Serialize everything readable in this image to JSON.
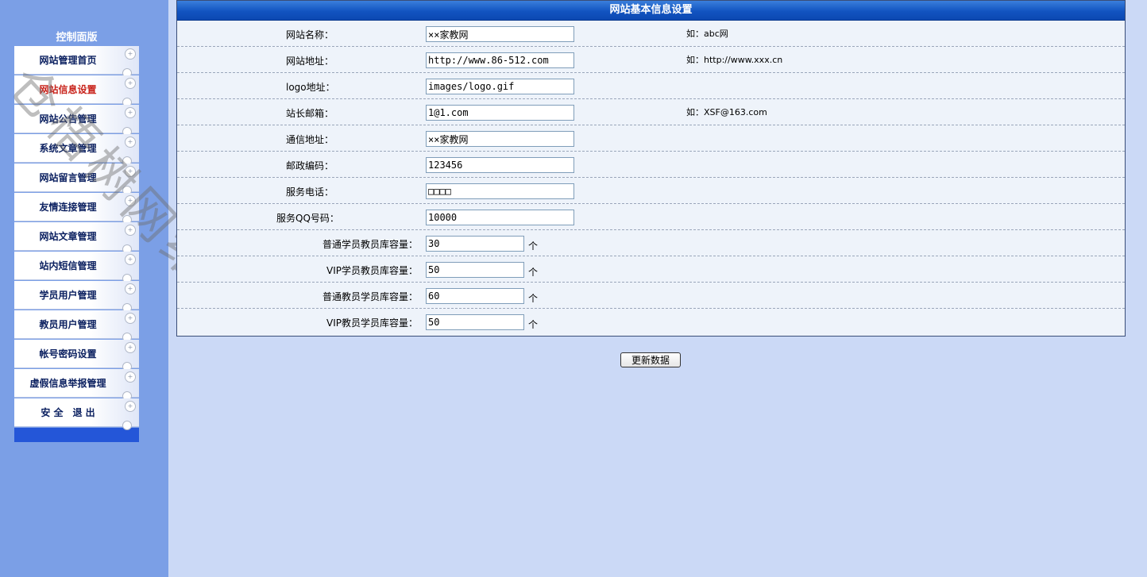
{
  "sidebar": {
    "title": "控制面版",
    "items": [
      {
        "label": "网站管理首页",
        "active": false
      },
      {
        "label": "网站信息设置",
        "active": true
      },
      {
        "label": "网站公告管理",
        "active": false
      },
      {
        "label": "系统文章管理",
        "active": false
      },
      {
        "label": "网站留言管理",
        "active": false
      },
      {
        "label": "友情连接管理",
        "active": false
      },
      {
        "label": "网站文章管理",
        "active": false
      },
      {
        "label": "站内短信管理",
        "active": false
      },
      {
        "label": "学员用户管理",
        "active": false
      },
      {
        "label": "教员用户管理",
        "active": false
      },
      {
        "label": "帐号密码设置",
        "active": false
      },
      {
        "label": "虚假信息举报管理",
        "active": false
      },
      {
        "label": "安 全　退 出",
        "active": false
      }
    ]
  },
  "watermark": "仓梧树网络",
  "panel": {
    "title": "网站基本信息设置",
    "rows": [
      {
        "label": "网站名称：",
        "value": "××家教网",
        "hint": "如：abc网"
      },
      {
        "label": "网站地址：",
        "value": "http://www.86-512.com",
        "hint": "如：http://www.xxx.cn"
      },
      {
        "label": "logo地址：",
        "value": "images/logo.gif",
        "hint": ""
      },
      {
        "label": "站长邮箱：",
        "value": "1@1.com",
        "hint": "如：XSF@163.com"
      },
      {
        "label": "通信地址：",
        "value": "××家教网",
        "hint": ""
      },
      {
        "label": "邮政编码：",
        "value": "123456",
        "hint": ""
      },
      {
        "label": "服务电话：",
        "value": "□□□□",
        "hint": ""
      },
      {
        "label": "服务QQ号码：",
        "value": "10000",
        "hint": ""
      }
    ],
    "capacity_rows": [
      {
        "label": "普通学员教员库容量：",
        "value": "30",
        "unit": "个"
      },
      {
        "label": "VIP学员教员库容量：",
        "value": "50",
        "unit": "个"
      },
      {
        "label": "普通教员学员库容量：",
        "value": "60",
        "unit": "个"
      },
      {
        "label": "VIP教员学员库容量：",
        "value": "50",
        "unit": "个"
      }
    ]
  },
  "update_button": "更新数据"
}
